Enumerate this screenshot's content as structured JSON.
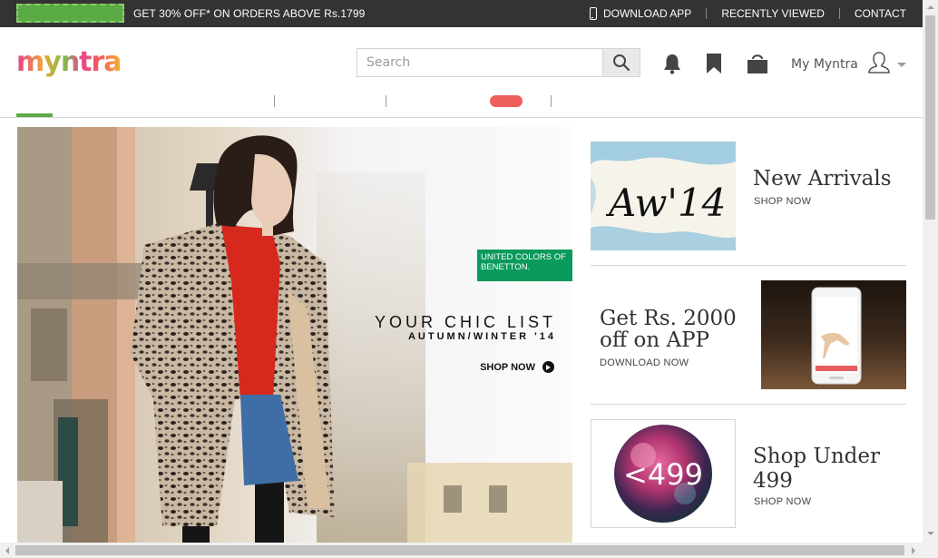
{
  "topbar": {
    "promo": "GET 30% OFF* ON ORDERS ABOVE Rs.1799",
    "download_app": "DOWNLOAD APP",
    "recently_viewed": "RECENTLY VIEWED",
    "contact": "CONTACT"
  },
  "header": {
    "logo_text": "myntra",
    "search_placeholder": "Search",
    "account_label": "My Myntra",
    "icons": [
      "bell-icon",
      "bookmark-icon",
      "shopping-bag-icon",
      "user-icon",
      "caret-down-icon"
    ]
  },
  "hero": {
    "brand": "UNITED COLORS OF BENETTON.",
    "title": "YOUR CHIC LIST",
    "subtitle": "AUTUMN/WINTER '14",
    "cta": "SHOP NOW"
  },
  "cards": [
    {
      "image_text": "Aw'14",
      "title": "New Arrivals",
      "link": "SHOP NOW"
    },
    {
      "title_line1": "Get Rs. 2000",
      "title_line2": "off on APP",
      "link": "DOWNLOAD NOW"
    },
    {
      "image_text": "<499",
      "title_line1": "Shop Under",
      "title_line2": "499",
      "link": "SHOP NOW"
    }
  ],
  "colors": {
    "topbar": "#333333",
    "accent_green": "#5bab44",
    "benetton_green": "#0a9a5b",
    "sale_pill": "#ee5f5b"
  }
}
